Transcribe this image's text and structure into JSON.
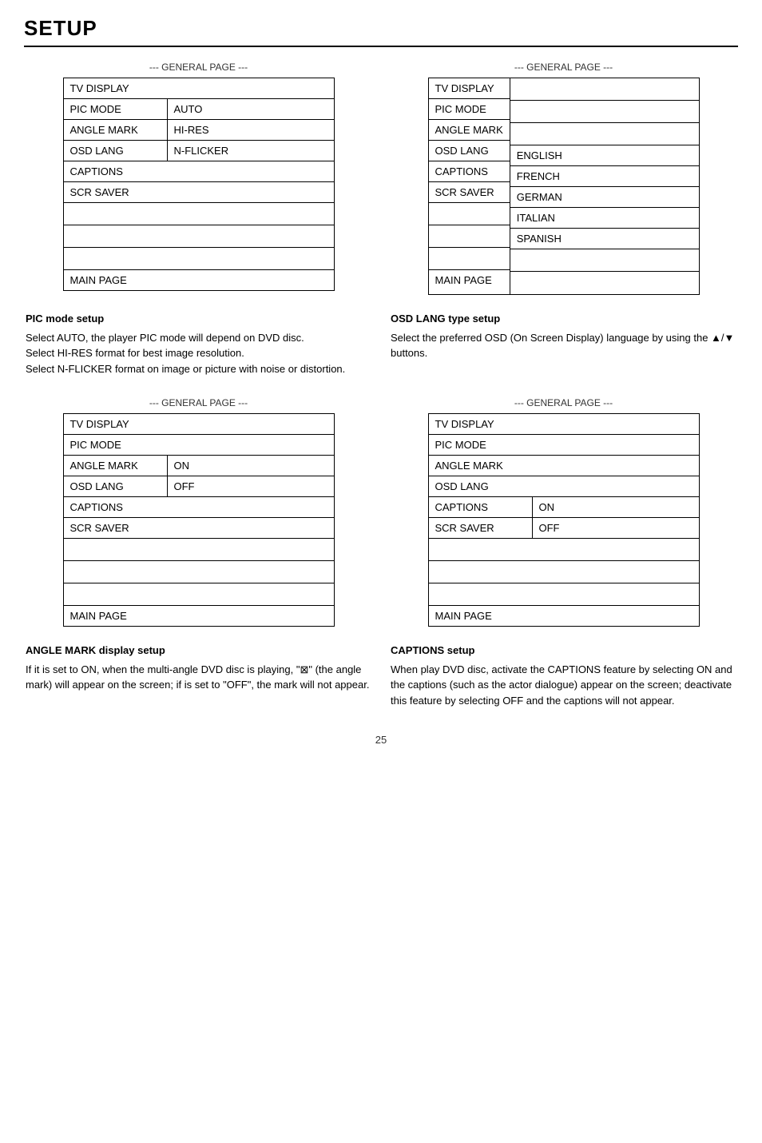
{
  "title": "SETUP",
  "page_number": "25",
  "general_page_label": "--- GENERAL PAGE ---",
  "panels": {
    "top_left": {
      "rows": [
        {
          "label": "TV DISPLAY",
          "value": ""
        },
        {
          "label": "PIC MODE",
          "value": "AUTO"
        },
        {
          "label": "ANGLE MARK",
          "value": "HI-RES"
        },
        {
          "label": "OSD LANG",
          "value": "N-FLICKER"
        },
        {
          "label": "CAPTIONS",
          "value": ""
        },
        {
          "label": "SCR SAVER",
          "value": ""
        }
      ],
      "footer": "MAIN PAGE"
    },
    "top_right": {
      "rows": [
        {
          "label": "TV DISPLAY",
          "value": ""
        },
        {
          "label": "PIC MODE",
          "value": ""
        },
        {
          "label": "ANGLE MARK",
          "value": ""
        },
        {
          "label": "OSD LANG",
          "value": "ENGLISH"
        },
        {
          "label": "CAPTIONS",
          "value": "FRENCH"
        },
        {
          "label": "SCR SAVER",
          "value": "GERMAN"
        }
      ],
      "extra_values": [
        "ITALIAN",
        "SPANISH"
      ],
      "footer": "MAIN PAGE"
    },
    "bottom_left": {
      "rows": [
        {
          "label": "TV DISPLAY",
          "value": ""
        },
        {
          "label": "PIC MODE",
          "value": ""
        },
        {
          "label": "ANGLE MARK",
          "value": "ON"
        },
        {
          "label": "OSD LANG",
          "value": "OFF"
        },
        {
          "label": "CAPTIONS",
          "value": ""
        },
        {
          "label": "SCR SAVER",
          "value": ""
        }
      ],
      "footer": "MAIN PAGE"
    },
    "bottom_right": {
      "rows": [
        {
          "label": "TV DISPLAY",
          "value": ""
        },
        {
          "label": "PIC MODE",
          "value": ""
        },
        {
          "label": "ANGLE MARK",
          "value": ""
        },
        {
          "label": "OSD LANG",
          "value": ""
        },
        {
          "label": "CAPTIONS",
          "value": "ON"
        },
        {
          "label": "SCR SAVER",
          "value": "OFF"
        }
      ],
      "footer": "MAIN PAGE"
    }
  },
  "descriptions": {
    "pic_mode": {
      "title": "PIC mode setup",
      "lines": [
        "Select AUTO, the player PIC mode will depend on DVD disc.",
        "Select HI-RES format for best image resolution.",
        "Select N-FLICKER format on image or picture with noise or distortion."
      ]
    },
    "osd_lang": {
      "title": "OSD LANG type setup",
      "lines": [
        "Select the preferred OSD (On Screen Display) language by using the ▲/▼ buttons."
      ]
    },
    "angle_mark": {
      "title": "ANGLE MARK display setup",
      "lines": [
        "If it is set to ON, when the multi-angle DVD disc is playing, \"⊠\" (the angle mark) will appear on the screen; if is set to \"OFF\", the mark will not appear."
      ]
    },
    "captions": {
      "title": "CAPTIONS setup",
      "lines": [
        "When play DVD disc, activate the CAPTIONS feature by selecting ON and the captions (such as the actor dialogue) appear on the screen; deactivate this feature by selecting OFF and the captions will not appear."
      ]
    }
  }
}
